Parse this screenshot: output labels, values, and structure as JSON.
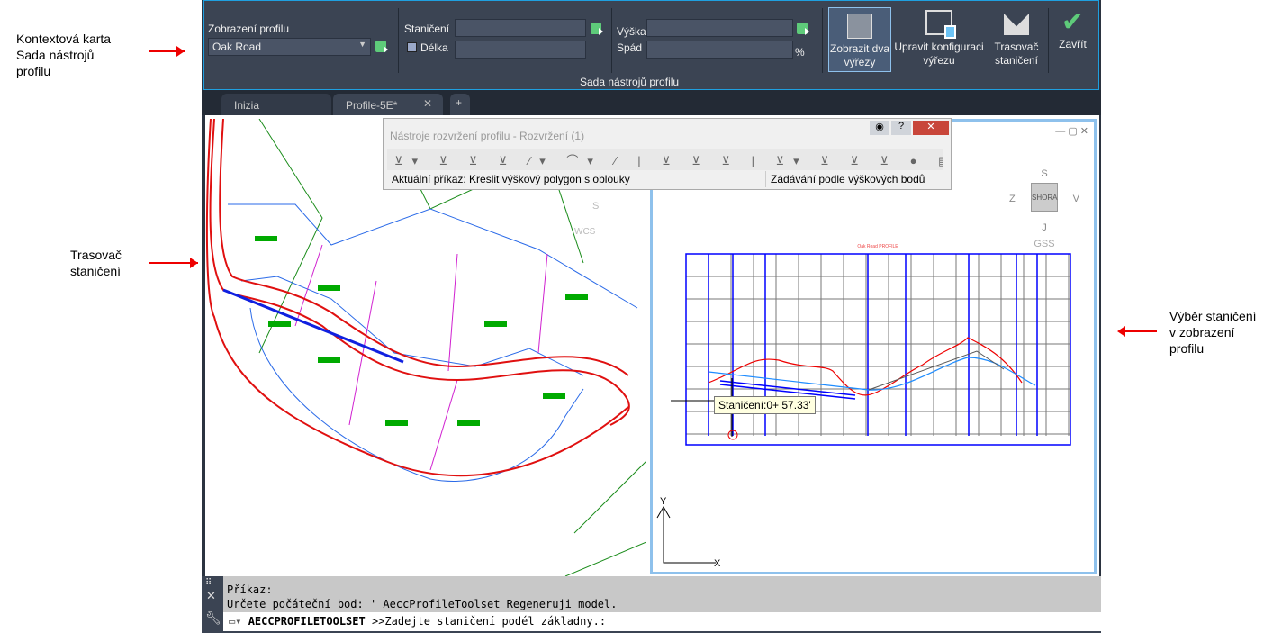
{
  "annotations": {
    "contextual_tab": [
      "Kontextová karta",
      "Sada nástrojů",
      "profilu"
    ],
    "station_tracker": [
      "Trasovač",
      "staničení"
    ],
    "station_selection": [
      "Výběr staničení",
      "v zobrazení",
      "profilu"
    ]
  },
  "ribbon": {
    "profile_view_label": "Zobrazení profilu",
    "profile_view_value": "Oak Road",
    "station_label": "Staničení",
    "length_label": "Délka",
    "length_checked": false,
    "elevation_label": "Výška",
    "grade_label": "Spád",
    "grade_unit": "%",
    "panel_title": "Sada nástrojů profilu",
    "buttons": {
      "two_viewports": [
        "Zobrazit dva",
        "výřezy"
      ],
      "edit_viewport": [
        "Upravit konfiguraci",
        "výřezu"
      ],
      "station_tracker": [
        "Trasovač",
        "staničení"
      ],
      "close": "Zavřít"
    }
  },
  "tabs": [
    {
      "label": "Inizia"
    },
    {
      "label": "Profile-5E*",
      "active": true
    }
  ],
  "palette": {
    "title": "Nástroje rozvržení profilu - Rozvržení (1)",
    "current_command": "Aktuální příkaz: Kreslit výškový polygon s oblouky",
    "input_mode": "Zádávání podle výškových bodů"
  },
  "viewport_left": {
    "compass_s": "S",
    "ucs": "WCS"
  },
  "viewport_right": {
    "viewcube": {
      "north": "S",
      "west": "Z",
      "east": "V",
      "south": "J",
      "face": "SHORA",
      "ucs": "GSS"
    },
    "profile_title": "Oak Road PROFILE",
    "tooltip": "Staničení:0+ 57.33'",
    "axis_x": "X",
    "axis_y": "Y"
  },
  "command_line": {
    "history": [
      "Příkaz:",
      "Určete počáteční bod: '_AeccProfileToolset Regeneruji model."
    ],
    "prompt_command": "AECCPROFILETOOLSET",
    "prompt_text": ">>Zadejte staničení podél základny.:"
  },
  "colors": {
    "accent": "#1fa0e0",
    "ribbon_bg": "#3b4453",
    "close_check": "#5ecb7a"
  }
}
